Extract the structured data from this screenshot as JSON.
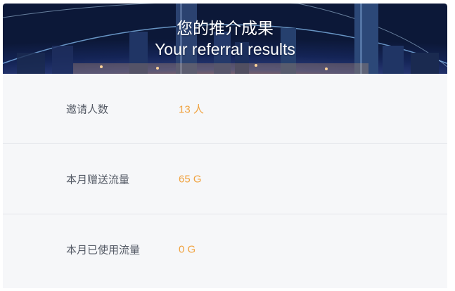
{
  "banner": {
    "title": "您的推介成果",
    "subtitle": "Your referral results"
  },
  "stats": [
    {
      "label": "邀请人数",
      "value": "13 人"
    },
    {
      "label": "本月赠送流量",
      "value": "65 G"
    },
    {
      "label": "本月已使用流量",
      "value": "0 G"
    }
  ],
  "colors": {
    "accent": "#f0a341",
    "label": "#555b66",
    "panel": "#f6f7f9",
    "divider": "#e4e6ea"
  }
}
